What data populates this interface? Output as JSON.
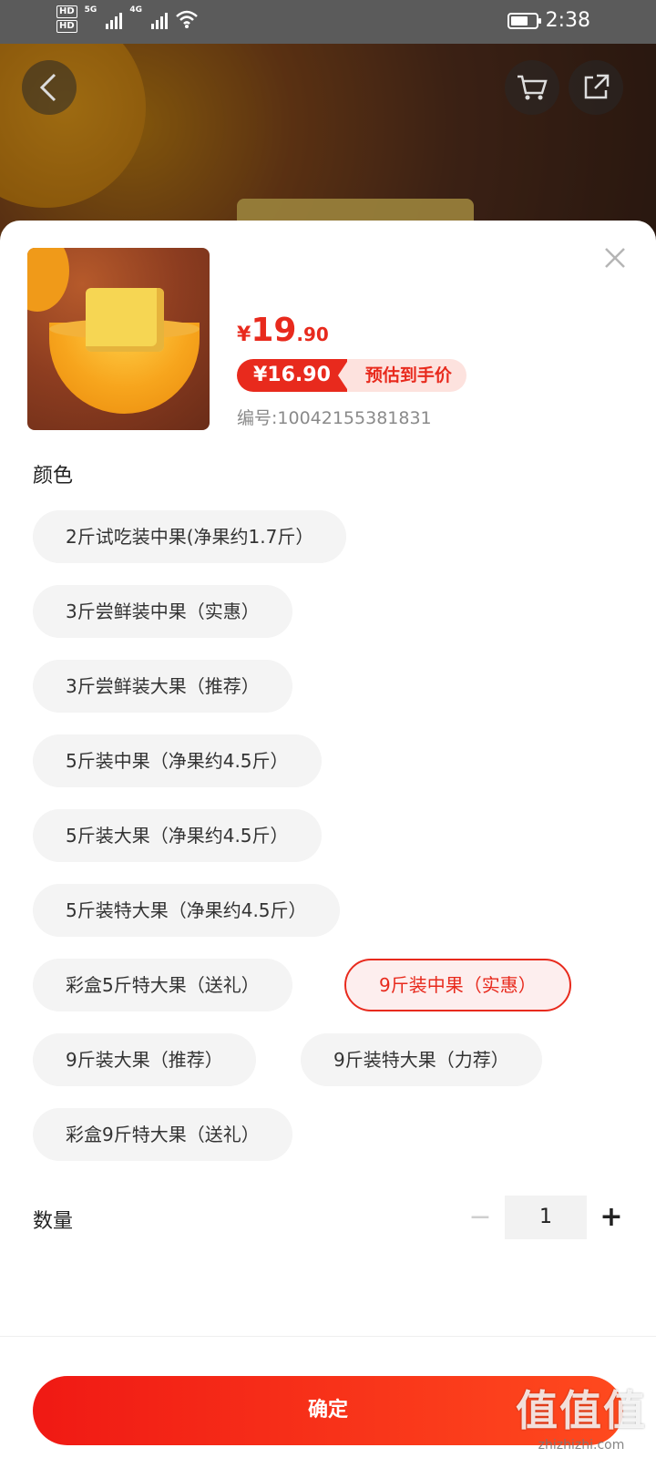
{
  "status_bar": {
    "time": "2:38",
    "hd1": "HD",
    "hd2": "HD",
    "net1": "5G",
    "net2": "4G"
  },
  "product": {
    "price_symbol": "¥",
    "price_int": "19",
    "price_dec": ".90",
    "promo_price": "¥16.90",
    "promo_label": "预估到手价",
    "sku": "编号:10042155381831"
  },
  "color_section": {
    "title": "颜色",
    "options": [
      "2斤试吃装中果(净果约1.7斤）",
      "3斤尝鲜装中果（实惠）",
      "3斤尝鲜装大果（推荐）",
      "5斤装中果（净果约4.5斤）",
      "5斤装大果（净果约4.5斤）",
      "5斤装特大果（净果约4.5斤）",
      "彩盒5斤特大果（送礼）",
      "9斤装中果（实惠）",
      "9斤装大果（推荐）",
      "9斤装特大果（力荐）",
      "彩盒9斤特大果（送礼）"
    ],
    "selected": "9斤装中果（实惠）"
  },
  "quantity": {
    "title": "数量",
    "value": "1",
    "minus": "−",
    "plus": "+"
  },
  "confirm_label": "确定",
  "watermark": {
    "line1": "值值值",
    "line2": "zhizhizhi.com"
  },
  "colors": {
    "accent": "#e82a1d",
    "chip_bg": "#f4f4f4"
  }
}
